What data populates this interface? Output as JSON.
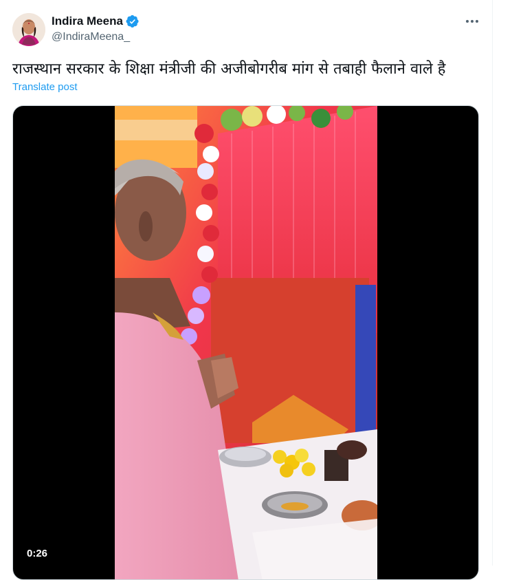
{
  "author": {
    "display_name": "Indira Meena",
    "handle": "@IndiraMeena_",
    "verified_icon": "verified-badge-icon",
    "accent": "#1d9bf0"
  },
  "post": {
    "text": "राजस्थान सरकार के शिक्षा मंत्रीजी की अजीबोगरीब मांग से तबाही फैलाने वाले है",
    "translate_label": "Translate post",
    "more_icon": "more-options-icon"
  },
  "video": {
    "duration": "0:26"
  }
}
